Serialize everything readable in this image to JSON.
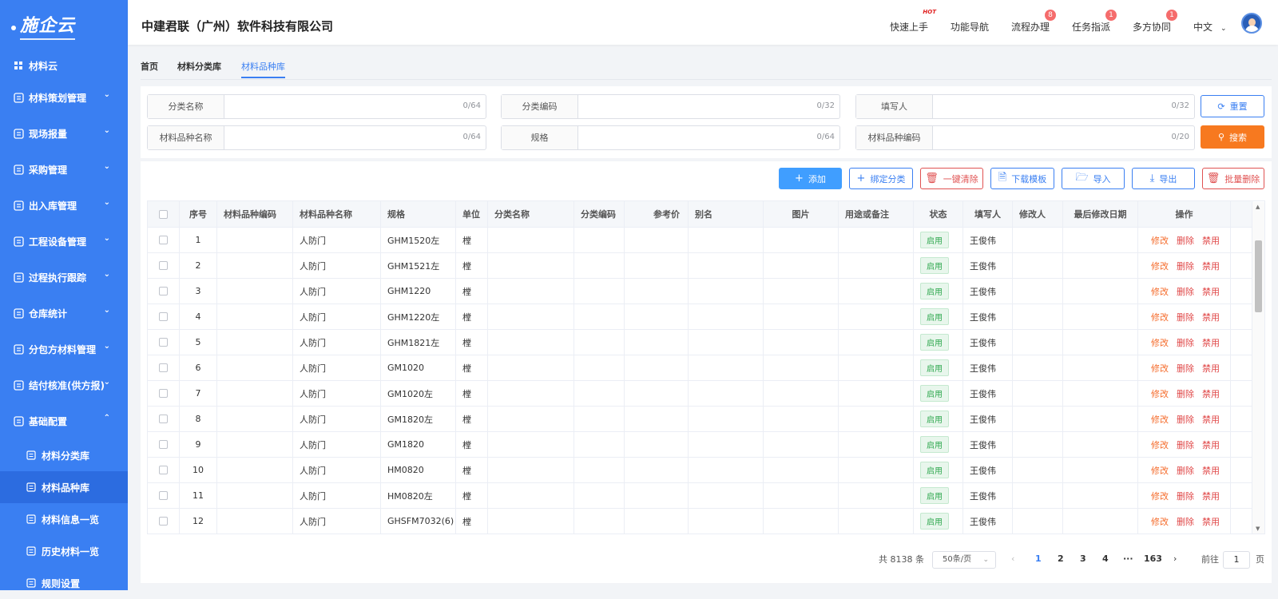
{
  "sidebar": {
    "logo": "施企云",
    "home": "材料云",
    "items": [
      {
        "label": "材料策划管理"
      },
      {
        "label": "现场报量"
      },
      {
        "label": "采购管理"
      },
      {
        "label": "出入库管理"
      },
      {
        "label": "工程设备管理"
      },
      {
        "label": "过程执行跟踪"
      },
      {
        "label": "仓库统计"
      },
      {
        "label": "分包方材料管理"
      },
      {
        "label": "结付核准(供方报)"
      },
      {
        "label": "基础配置"
      }
    ],
    "sub_items": [
      {
        "label": "材料分类库"
      },
      {
        "label": "材料品种库"
      },
      {
        "label": "材料信息一览"
      },
      {
        "label": "历史材料一览"
      },
      {
        "label": "规则设置"
      }
    ]
  },
  "header": {
    "company": "中建君联（广州）软件科技有限公司",
    "nav": [
      {
        "label": "快速上手",
        "badge": "HOT"
      },
      {
        "label": "功能导航",
        "badge": ""
      },
      {
        "label": "流程办理",
        "badge": "8"
      },
      {
        "label": "任务指派",
        "badge": "1"
      },
      {
        "label": "多方协同",
        "badge": "1"
      }
    ],
    "language": "中文"
  },
  "tabs": [
    "首页",
    "材料分类库",
    "材料品种库"
  ],
  "filters": [
    {
      "label": "分类名称",
      "count": "0/64"
    },
    {
      "label": "分类编码",
      "count": "0/32"
    },
    {
      "label": "填写人",
      "count": "0/32"
    },
    {
      "label": "材料品种名称",
      "count": "0/64"
    },
    {
      "label": "规格",
      "count": "0/64"
    },
    {
      "label": "材料品种编码",
      "count": "0/20"
    }
  ],
  "buttons": {
    "reset": "重置",
    "search": "搜索",
    "add": "添加",
    "bind": "绑定分类",
    "clear": "一键清除",
    "download": "下载模板",
    "import": "导入",
    "export": "导出",
    "batch_delete": "批量删除"
  },
  "table": {
    "columns": [
      "序号",
      "材料品种编码",
      "材料品种名称",
      "规格",
      "单位",
      "分类名称",
      "分类编码",
      "参考价",
      "别名",
      "图片",
      "用途或备注",
      "状态",
      "填写人",
      "修改人",
      "最后修改日期",
      "操作"
    ],
    "rows": [
      {
        "no": "1",
        "name": "人防门",
        "spec": "GHM1520左",
        "unit": "樘",
        "status": "启用",
        "writer": "王俊伟"
      },
      {
        "no": "2",
        "name": "人防门",
        "spec": "GHM1521左",
        "unit": "樘",
        "status": "启用",
        "writer": "王俊伟"
      },
      {
        "no": "3",
        "name": "人防门",
        "spec": "GHM1220",
        "unit": "樘",
        "status": "启用",
        "writer": "王俊伟"
      },
      {
        "no": "4",
        "name": "人防门",
        "spec": "GHM1220左",
        "unit": "樘",
        "status": "启用",
        "writer": "王俊伟"
      },
      {
        "no": "5",
        "name": "人防门",
        "spec": "GHM1821左",
        "unit": "樘",
        "status": "启用",
        "writer": "王俊伟"
      },
      {
        "no": "6",
        "name": "人防门",
        "spec": "GM1020",
        "unit": "樘",
        "status": "启用",
        "writer": "王俊伟"
      },
      {
        "no": "7",
        "name": "人防门",
        "spec": "GM1020左",
        "unit": "樘",
        "status": "启用",
        "writer": "王俊伟"
      },
      {
        "no": "8",
        "name": "人防门",
        "spec": "GM1820左",
        "unit": "樘",
        "status": "启用",
        "writer": "王俊伟"
      },
      {
        "no": "9",
        "name": "人防门",
        "spec": "GM1820",
        "unit": "樘",
        "status": "启用",
        "writer": "王俊伟"
      },
      {
        "no": "10",
        "name": "人防门",
        "spec": "HM0820",
        "unit": "樘",
        "status": "启用",
        "writer": "王俊伟"
      },
      {
        "no": "11",
        "name": "人防门",
        "spec": "HM0820左",
        "unit": "樘",
        "status": "启用",
        "writer": "王俊伟"
      },
      {
        "no": "12",
        "name": "人防门",
        "spec": "GHSFM7032(6)",
        "unit": "樘",
        "status": "启用",
        "writer": "王俊伟"
      }
    ],
    "ops": [
      "修改",
      "删除",
      "禁用"
    ]
  },
  "pagination": {
    "total": "共 8138 条",
    "page_size": "50条/页",
    "pages": [
      "1",
      "2",
      "3",
      "4",
      "···",
      "163"
    ],
    "jump_prefix": "前往",
    "jump_value": "1",
    "jump_suffix": "页"
  }
}
